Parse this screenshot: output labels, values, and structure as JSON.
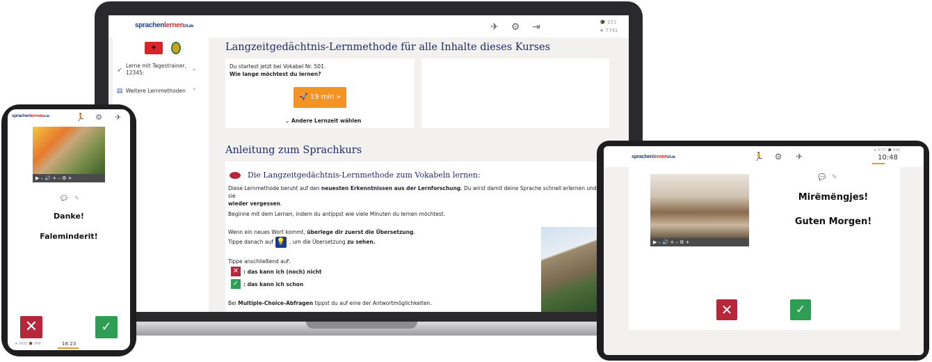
{
  "brand": {
    "logo_part1": "sprachen",
    "logo_part2": "lernen",
    "logo_part3": "24.de",
    "color_blue": "#1f3c88",
    "color_red": "#d32f2f"
  },
  "laptop": {
    "toolbar": {
      "icons": [
        "airplane-icon",
        "gear-icon",
        "logout-icon"
      ],
      "stat_top": "151",
      "stat_bottom": "7741"
    },
    "sidebar": {
      "flag_left": "albania-flag",
      "flag_right": "portugal-flag",
      "items": [
        {
          "label_line1": "Lerne mit Tagestrainer,",
          "label_line2": "12345:",
          "icon": "rocket-icon"
        },
        {
          "label_line1": "Weitere Lernmethoden",
          "label_line2": "",
          "icon": "book-icon"
        }
      ]
    },
    "main": {
      "heading": "Langzeitgedächtnis-Lernmethode für alle Inhalte dieses Kurses",
      "start_info": "Du startest jetzt bei Vokabel Nr. 501.",
      "question": "Wie lange möchtest du lernen?",
      "start_button": "19 min  »",
      "other_time": "Andere Lernzeit wählen",
      "section_heading": "Anleitung zum Sprachkurs",
      "method_heading": "Die Langzeitgedächtnis-Lernmethode zum Vokabeln lernen:",
      "para1_a": "Diese Lernmethode beruht auf den ",
      "para1_b": "neuesten Erkenntnissen aus der Lernforschung",
      "para1_c": ". Du wirst damit deine Sprache schnell erlernen und sie",
      "para1_d": "wieder vergessen",
      "para1_e": ".",
      "para2": "Beginne mit dem Lernen, indem du antippst wie viele Minuten du lernen möchtest.",
      "para3_a": "Wenn ein neues Wort kommt, ",
      "para3_b": "überlege dir zuerst die Übersetzung",
      "para3_c": ".",
      "para4_a": "Tippe danach auf ",
      "para4_b": ", um die Übersetzung ",
      "para4_c": "zu sehen.",
      "para5": "Tippe anschließend auf:",
      "no_label": ": das kann ich (noch) nicht",
      "yes_label": ": das kann ich schon",
      "para6_a": "Bei ",
      "para6_b": "Multiple-Choice-Abfragen",
      "para6_c": " tippst du auf eine der Antwortmöglichkeiten."
    }
  },
  "phone": {
    "toolbar_icons": [
      "runner-icon",
      "gear-icon",
      "airplane-icon"
    ],
    "phrase_1": "Danke!",
    "phrase_2": "Faleminderit!",
    "time": "16:23",
    "stat_left": "6681",
    "stat_right": "848"
  },
  "tablet": {
    "toolbar_icons": [
      "runner-icon",
      "gear-icon",
      "airplane-icon"
    ],
    "stat_left": "8757",
    "stat_right": "646",
    "time": "10:48",
    "phrase_1": "Mirëmëngjes!",
    "phrase_2": "Guten Morgen!"
  },
  "colors": {
    "no_red": "#b8263c",
    "yes_green": "#2e9e55",
    "accent_orange": "#f39323",
    "heading_navy": "#1f2a6b"
  }
}
